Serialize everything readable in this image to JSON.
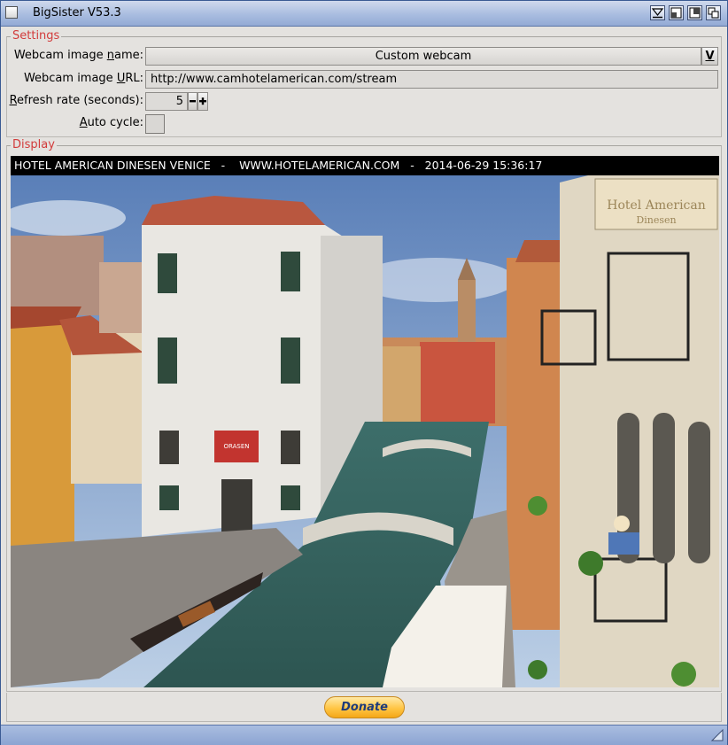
{
  "window": {
    "title": "BigSister V53.3"
  },
  "settings": {
    "group_label": "Settings",
    "webcam_name_label_pre": "Webcam image ",
    "webcam_name_label_u": "n",
    "webcam_name_label_post": "ame:",
    "webcam_name_value": "Custom webcam",
    "cycle_glyph": "V",
    "webcam_url_label_pre": "Webcam image ",
    "webcam_url_label_u": "U",
    "webcam_url_label_post": "RL:",
    "webcam_url_value": "http://www.camhotelamerican.com/stream",
    "refresh_label_u": "R",
    "refresh_label_post": "efresh rate (seconds):",
    "refresh_value": "5",
    "auto_cycle_label_u": "A",
    "auto_cycle_label_post": "uto cycle:",
    "auto_cycle_checked": false
  },
  "display": {
    "group_label": "Display",
    "cam_caption": "HOTEL AMERICAN DINESEN VENICE   -    WWW.HOTELAMERICAN.COM   -   2014-06-29 15:36:17",
    "hotel_sign_line1": "Hotel American",
    "hotel_sign_line2": "Dinesen",
    "shop_sign": "ORASEN"
  },
  "footer": {
    "donate_label": "Donate"
  }
}
